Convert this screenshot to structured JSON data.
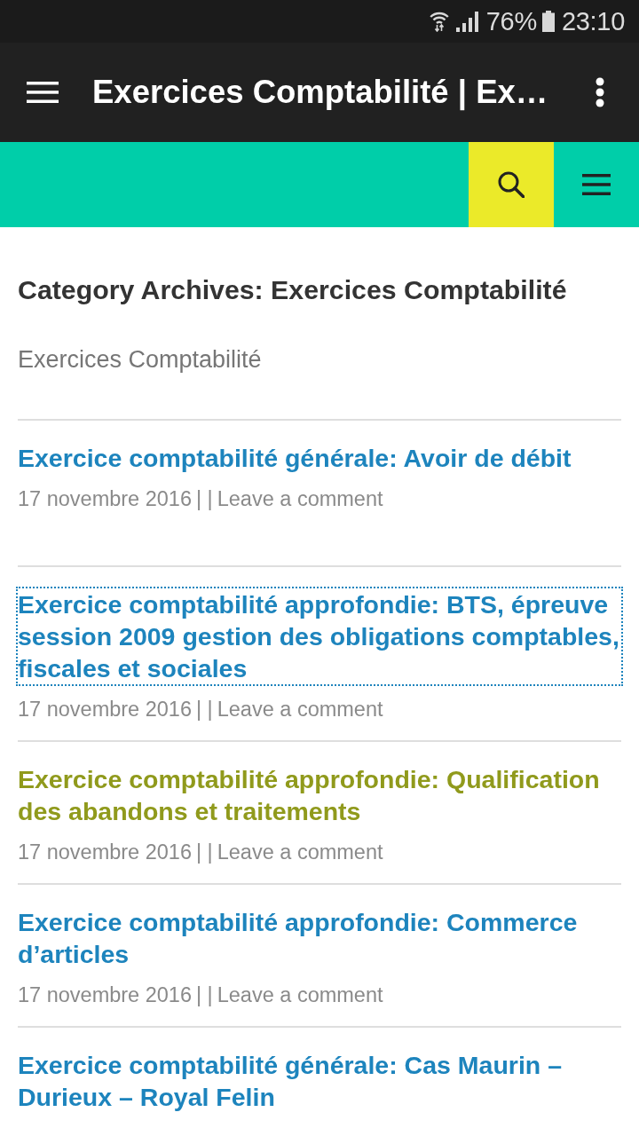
{
  "status_bar": {
    "battery_percent": "76%",
    "time": "23:10"
  },
  "app_bar": {
    "title": "Exercices Comptabilité | Ex…"
  },
  "archive": {
    "heading": "Category Archives: Exercices Comptabilité",
    "description": "Exercices Comptabilité"
  },
  "posts": [
    {
      "title": "Exercice comptabilité générale: Avoir de débit",
      "visited": false,
      "focused": false,
      "meta": {
        "date": "17 novembre 2016",
        "separator": "| |",
        "comment_link": "Leave a comment"
      }
    },
    {
      "title": "Exercice comptabilité approfondie: BTS, épreuve session 2009 gestion des obligations comptables, fiscales et sociales",
      "visited": false,
      "focused": true,
      "meta": {
        "date": "17 novembre 2016",
        "separator": "| |",
        "comment_link": "Leave a comment"
      }
    },
    {
      "title": "Exercice comptabilité approfondie: Qualification des abandons et traitements",
      "visited": true,
      "focused": false,
      "meta": {
        "date": "17 novembre 2016",
        "separator": "| |",
        "comment_link": "Leave a comment"
      }
    },
    {
      "title": "Exercice comptabilité approfondie: Commerce d’articles",
      "visited": false,
      "focused": false,
      "meta": {
        "date": "17 novembre 2016",
        "separator": "| |",
        "comment_link": "Leave a comment"
      }
    },
    {
      "title": "Exercice comptabilité générale: Cas Maurin – Durieux – Royal Felin",
      "visited": false,
      "focused": false
    }
  ]
}
